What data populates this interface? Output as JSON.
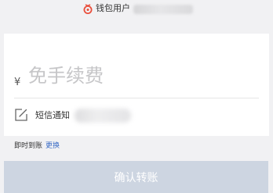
{
  "header": {
    "title": "钱包用户",
    "icon": "wallet-icon",
    "accent_color": "#e94e3b"
  },
  "transfer": {
    "currency_symbol": "¥",
    "amount_value": "",
    "amount_placeholder": "免手续费",
    "note_icon": "edit-icon",
    "note_label": "短信通知",
    "arrival_label": "即时到账",
    "change_link": "更换",
    "confirm_label": "确认转账"
  },
  "colors": {
    "link": "#3a6cc6",
    "button_disabled": "#cdd5e1",
    "background": "#f1f1f3"
  }
}
